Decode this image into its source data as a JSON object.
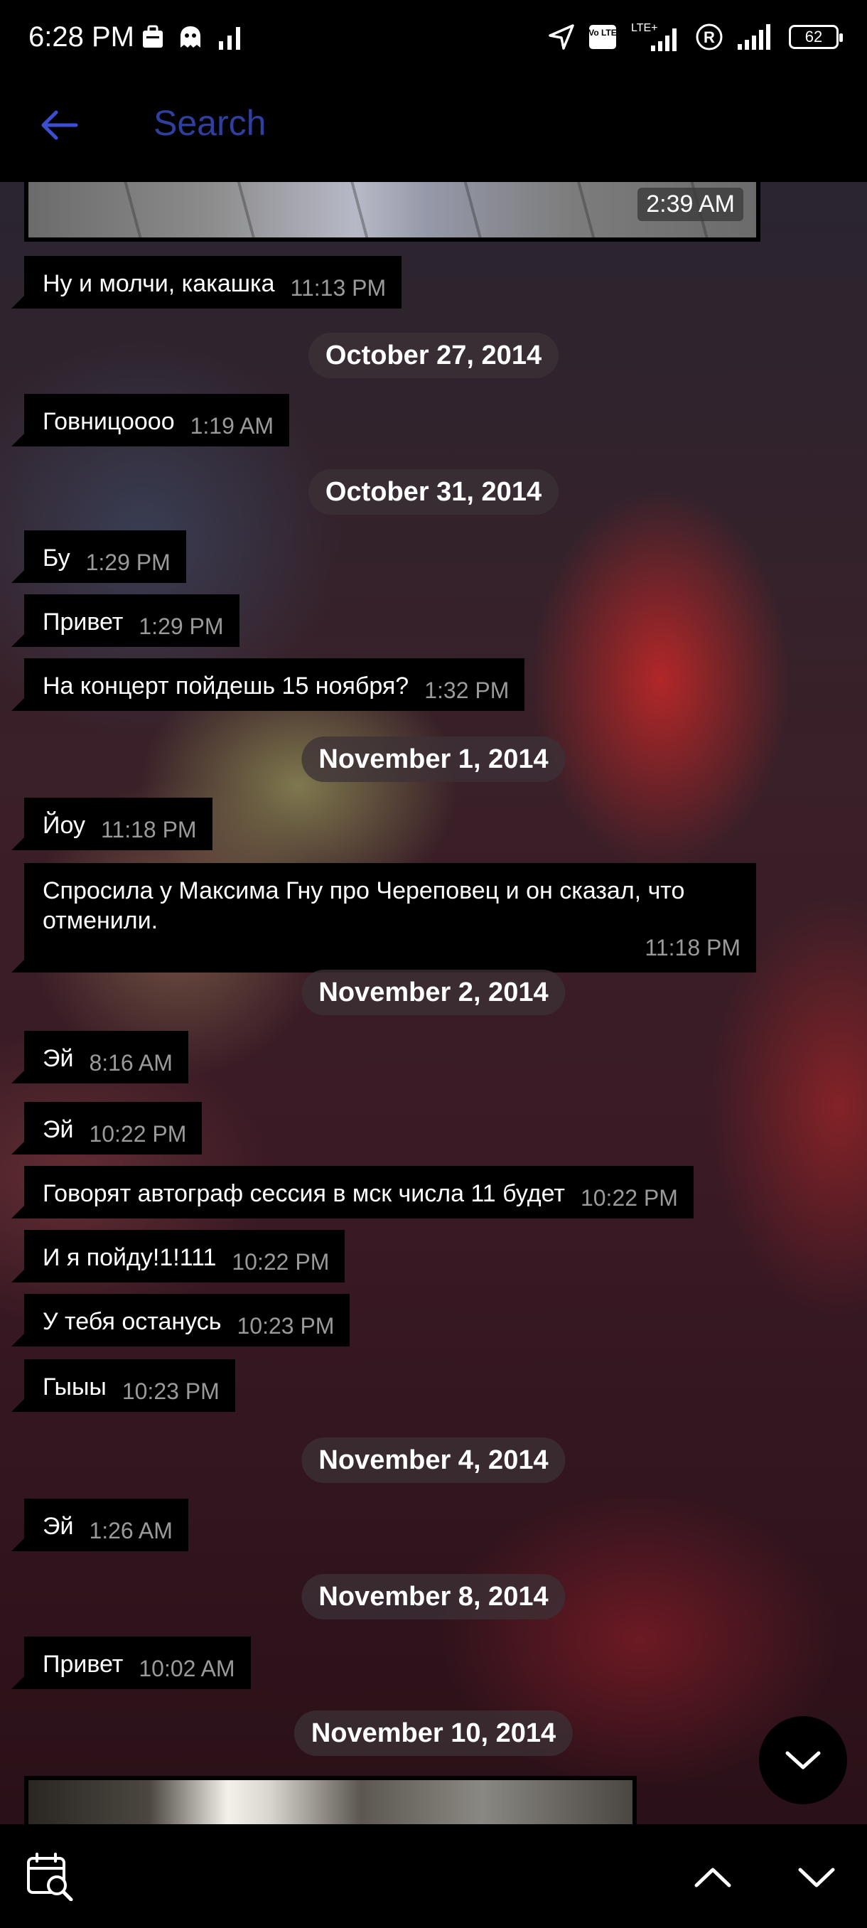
{
  "status_bar": {
    "time": "6:28 PM",
    "battery": "62",
    "icons": [
      "briefcase-icon",
      "ghost-icon",
      "signal-icon",
      "navigation-icon",
      "volte-icon",
      "lte-signal-icon",
      "roaming-icon",
      "signal-icon",
      "battery-icon"
    ],
    "volte": "Vo LTE",
    "lte": "LTE+",
    "roaming": "R"
  },
  "header": {
    "title": "Search",
    "back_icon": "arrow-left-icon",
    "accent": "#3b4fd0"
  },
  "chat": {
    "top_media_time": "2:39 AM",
    "messages": [
      {
        "text": "Ну и молчи, какашка",
        "time": "11:13 PM"
      },
      {
        "text": "Говницоооо",
        "time": "1:19 AM"
      },
      {
        "text": "Бу",
        "time": "1:29 PM"
      },
      {
        "text": "Привет",
        "time": "1:29 PM"
      },
      {
        "text": "На концерт пойдешь 15 ноября?",
        "time": "1:32 PM"
      },
      {
        "text": "Йоу",
        "time": "11:18 PM"
      },
      {
        "text": "Спросила у Максима Гну про Череповец и он сказал, что отменили.",
        "time": "11:18 PM"
      },
      {
        "text": "Эй",
        "time": "8:16 AM"
      },
      {
        "text": "Эй",
        "time": "10:22 PM"
      },
      {
        "text": "Говорят автограф сессия в мск числа 11 будет",
        "time": "10:22 PM"
      },
      {
        "text": "И я пойду!1!111",
        "time": "10:22 PM"
      },
      {
        "text": "У тебя останусь",
        "time": "10:23 PM"
      },
      {
        "text": "Гыыы",
        "time": "10:23 PM"
      },
      {
        "text": "Эй",
        "time": "1:26 AM"
      },
      {
        "text": "Привет",
        "time": "10:02 AM"
      }
    ],
    "dates": [
      "October 27, 2014",
      "October 31, 2014",
      "November 1, 2014",
      "November 2, 2014",
      "November 4, 2014",
      "November 8, 2014",
      "November 10, 2014"
    ]
  },
  "bottom_bar": {
    "icons": [
      "calendar-search-icon",
      "chevron-up-icon",
      "chevron-down-icon"
    ]
  },
  "fab": {
    "icon": "chevron-down-icon"
  }
}
